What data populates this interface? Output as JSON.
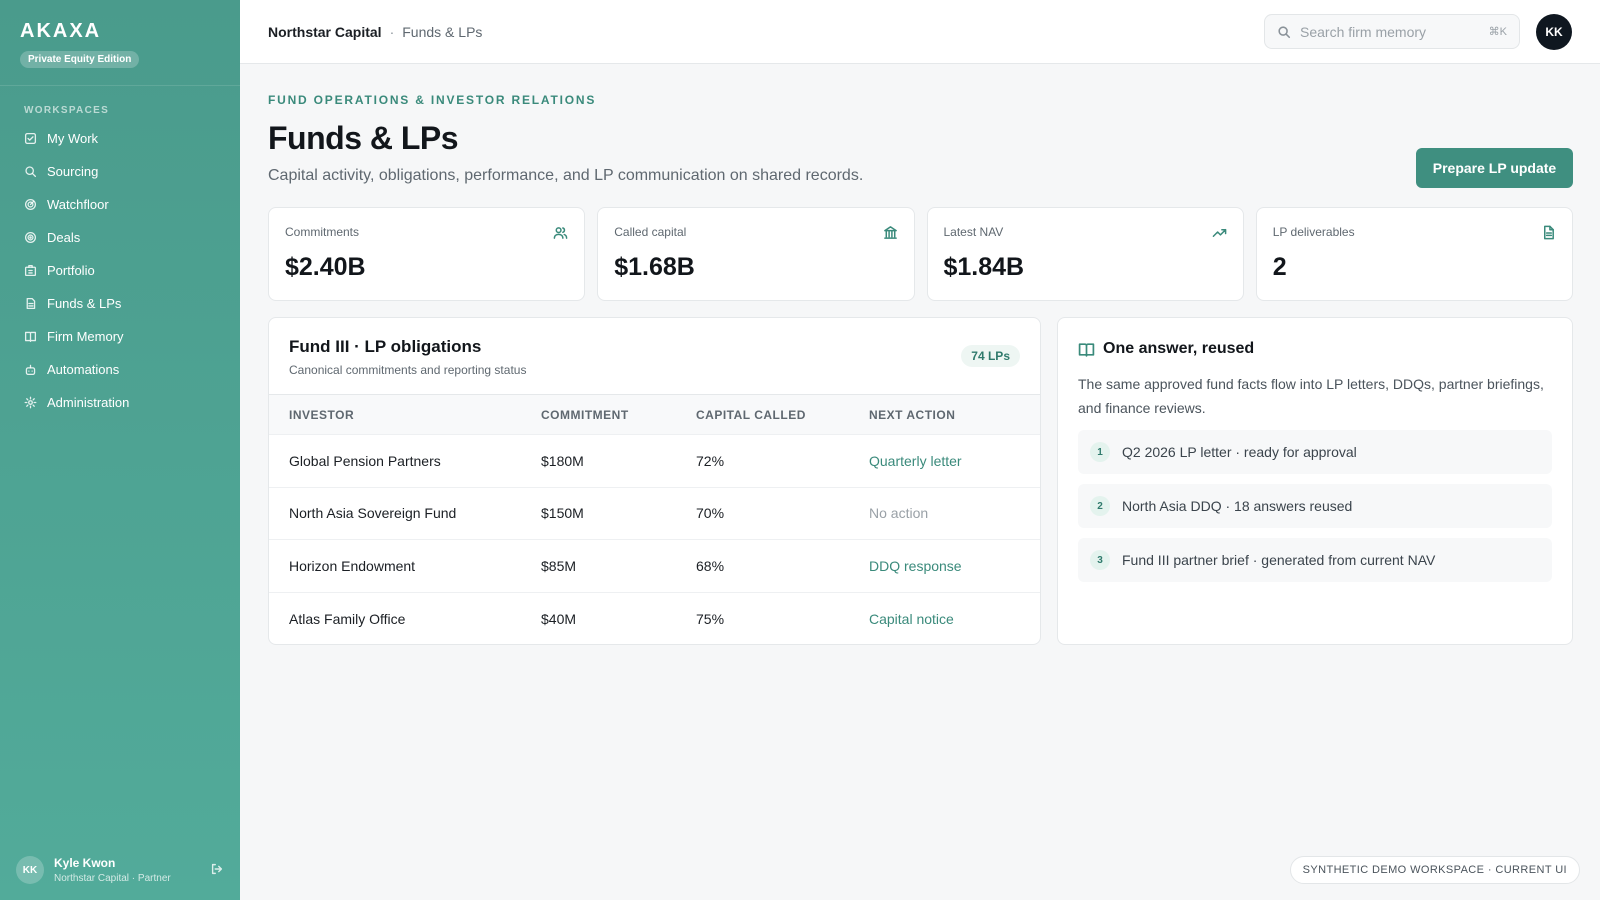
{
  "sidebar": {
    "brand": "AKAXA",
    "edition": "Private Equity Edition",
    "section_label": "WORKSPACES",
    "items": [
      {
        "label": "My Work",
        "icon": "check-square-icon"
      },
      {
        "label": "Sourcing",
        "icon": "search-icon"
      },
      {
        "label": "Watchfloor",
        "icon": "radar-icon"
      },
      {
        "label": "Deals",
        "icon": "target-icon"
      },
      {
        "label": "Portfolio",
        "icon": "building-icon"
      },
      {
        "label": "Funds & LPs",
        "icon": "file-icon"
      },
      {
        "label": "Firm Memory",
        "icon": "book-icon"
      },
      {
        "label": "Automations",
        "icon": "robot-icon"
      },
      {
        "label": "Administration",
        "icon": "gear-icon"
      }
    ],
    "user": {
      "initials": "KK",
      "name": "Kyle Kwon",
      "role": "Northstar Capital · Partner"
    }
  },
  "topbar": {
    "org": "Northstar Capital",
    "separator": "·",
    "page": "Funds & LPs",
    "search_placeholder": "Search firm memory",
    "search_shortcut": "⌘K",
    "avatar_initials": "KK"
  },
  "header": {
    "eyebrow": "FUND OPERATIONS & INVESTOR RELATIONS",
    "title": "Funds & LPs",
    "subtitle": "Capital activity, obligations, performance, and LP communication on shared records.",
    "primary_action": "Prepare LP update"
  },
  "kpis": [
    {
      "label": "Commitments",
      "value": "$2.40B",
      "icon": "users-icon"
    },
    {
      "label": "Called capital",
      "value": "$1.68B",
      "icon": "bank-icon"
    },
    {
      "label": "Latest NAV",
      "value": "$1.84B",
      "icon": "trending-up-icon"
    },
    {
      "label": "LP deliverables",
      "value": "2",
      "icon": "document-icon"
    }
  ],
  "obligations": {
    "title": "Fund III · LP obligations",
    "subtitle": "Canonical commitments and reporting status",
    "badge": "74 LPs",
    "columns": [
      "INVESTOR",
      "COMMITMENT",
      "CAPITAL CALLED",
      "NEXT ACTION"
    ],
    "rows": [
      {
        "investor": "Global Pension Partners",
        "commitment": "$180M",
        "called": "72%",
        "action": "Quarterly letter"
      },
      {
        "investor": "North Asia Sovereign Fund",
        "commitment": "$150M",
        "called": "70%",
        "action": "No action"
      },
      {
        "investor": "Horizon Endowment",
        "commitment": "$85M",
        "called": "68%",
        "action": "DDQ response"
      },
      {
        "investor": "Atlas Family Office",
        "commitment": "$40M",
        "called": "75%",
        "action": "Capital notice"
      }
    ]
  },
  "answer": {
    "title": "One answer, reused",
    "description": "The same approved fund facts flow into LP letters, DDQs, partner briefings, and finance reviews.",
    "items": [
      {
        "num": "1",
        "text": "Q2 2026 LP letter · ready for approval"
      },
      {
        "num": "2",
        "text": "North Asia DDQ · 18 answers reused"
      },
      {
        "num": "3",
        "text": "Fund III partner brief · generated from current NAV"
      }
    ]
  },
  "footer": {
    "note": "SYNTHETIC DEMO WORKSPACE · CURRENT UI"
  },
  "colors": {
    "accent": "#3f8f80",
    "sidebar": "#4a9b8c"
  }
}
